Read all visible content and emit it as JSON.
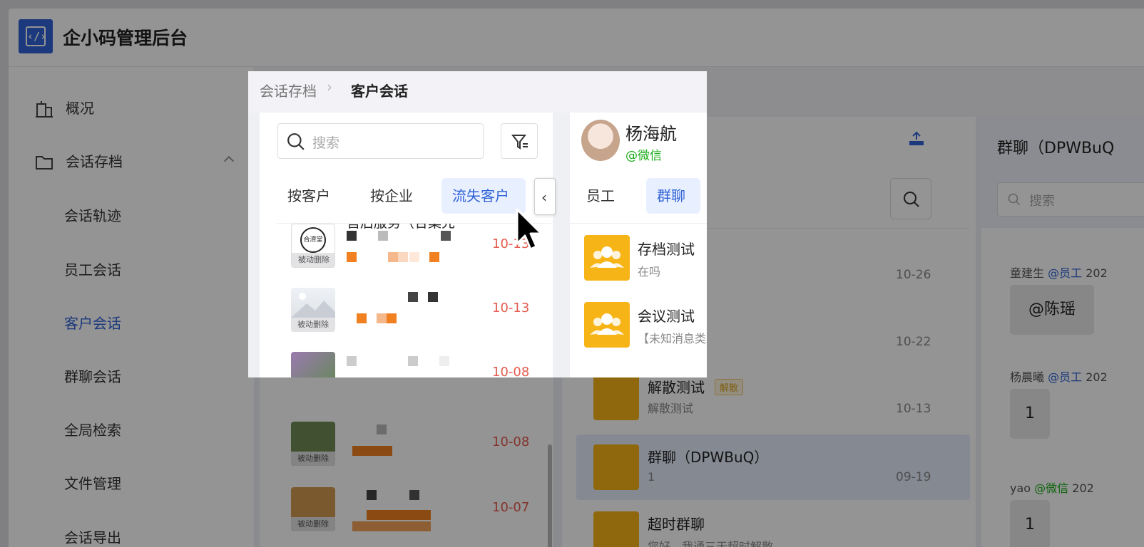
{
  "app": {
    "title": "企小码管理后台",
    "logo_icon": "code-icon"
  },
  "sidebar": {
    "items": [
      {
        "label": "概况",
        "icon": "building-icon"
      },
      {
        "label": "会话存档",
        "icon": "folder-icon"
      },
      {
        "label": "会话轨迹"
      },
      {
        "label": "员工会话"
      },
      {
        "label": "客户会话"
      },
      {
        "label": "群聊会话"
      },
      {
        "label": "全局检索"
      },
      {
        "label": "文件管理"
      },
      {
        "label": "会话导出"
      }
    ]
  },
  "breadcrumb": {
    "parent": "会话存档",
    "current": "客户会话"
  },
  "left_panel": {
    "search_placeholder": "搜索",
    "tabs": [
      "按客户",
      "按企业",
      "流失客户"
    ],
    "active_tab": "流失客户",
    "first_row_name": "售后服务（合集先",
    "deleted_badge": "被动删除",
    "rows": [
      {
        "date": "10-13"
      },
      {
        "date": "10-13"
      },
      {
        "date": "10-08"
      },
      {
        "date": "10-08"
      },
      {
        "date": "10-07"
      }
    ]
  },
  "middle_panel": {
    "user_name": "杨海航",
    "user_source": "@微信",
    "tabs": [
      "员工",
      "群聊"
    ],
    "active_tab": "群聊",
    "dissolved_tag": "解散",
    "groups": [
      {
        "name": "存档测试",
        "last": "在吗",
        "date": "10-26"
      },
      {
        "name": "会议测试",
        "last": "【未知消息类型】",
        "date": "10-22"
      },
      {
        "name": "解散测试",
        "last": "解散测试",
        "date": "10-13"
      },
      {
        "name": "群聊（DPWBuQ）",
        "last": "1",
        "date": "09-19"
      },
      {
        "name": "超时群聊",
        "last": "您好，我通三天超时解散",
        "date": ""
      }
    ]
  },
  "right_panel": {
    "title": "群聊（DPWBuQ",
    "search_placeholder": "搜索",
    "messages": [
      {
        "sender": "童建生",
        "tag": "@员工",
        "year": "202",
        "text": "@陈瑶"
      },
      {
        "sender": "杨晨曦",
        "tag": "@员工",
        "year": "202",
        "text": "1"
      },
      {
        "sender": "yao",
        "tag": "@微信",
        "year": "202",
        "text": "1"
      }
    ]
  },
  "colors": {
    "accent": "#2f62d6",
    "group_icon": "#f7b417",
    "date_red": "#e45b4f",
    "wechat_green": "#1aad19"
  }
}
